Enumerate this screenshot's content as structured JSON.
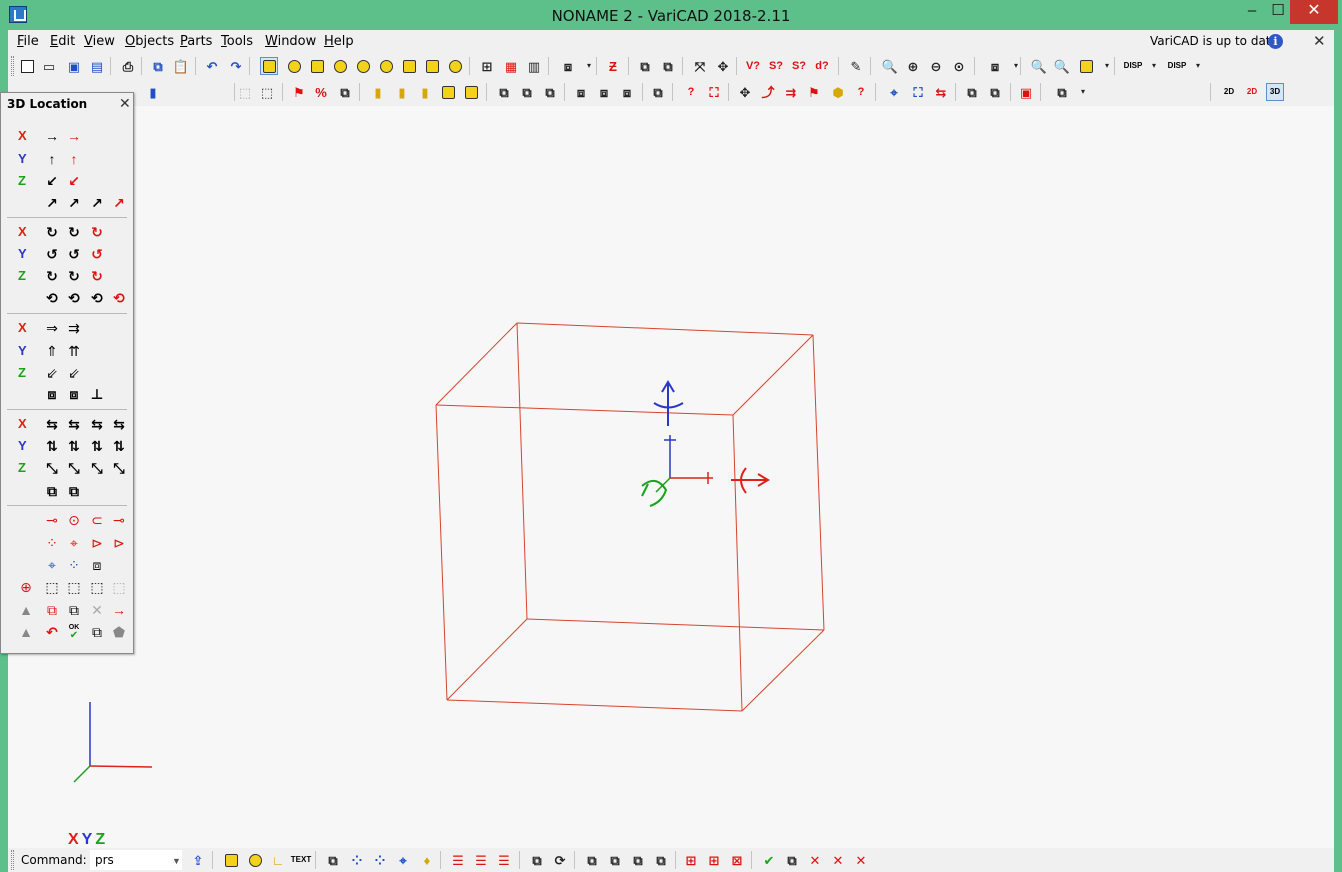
{
  "window": {
    "title": "NONAME 2 - VariCAD 2018-2.11",
    "minimize": "–",
    "maximize": "☐",
    "close": "✕"
  },
  "menu": {
    "items": [
      "File",
      "Edit",
      "View",
      "Objects",
      "Parts",
      "Tools",
      "Window",
      "Help"
    ],
    "status": "VariCAD is up to date",
    "close": "✕"
  },
  "toolbar": {
    "disp1": "DISP",
    "disp2": "DISP",
    "view2d": "2D",
    "view2d3d": "2D",
    "view3d": "3D"
  },
  "panel": {
    "title": "3D Location",
    "close": "✕",
    "labels": [
      "X",
      "Y",
      "Z"
    ],
    "ok": "OK"
  },
  "canvas": {
    "axis_x": "X",
    "axis_y": "Y",
    "axis_z": "Z"
  },
  "command": {
    "label": "Command:",
    "value": "prs",
    "text_icon": "TEXT"
  },
  "colors": {
    "frame": "#5dbf8a",
    "box_edges": "#d8432a",
    "axis_x": "#e0201a",
    "axis_y": "#2a38c8",
    "axis_z": "#1aa31a",
    "close_button": "#c7362d"
  }
}
